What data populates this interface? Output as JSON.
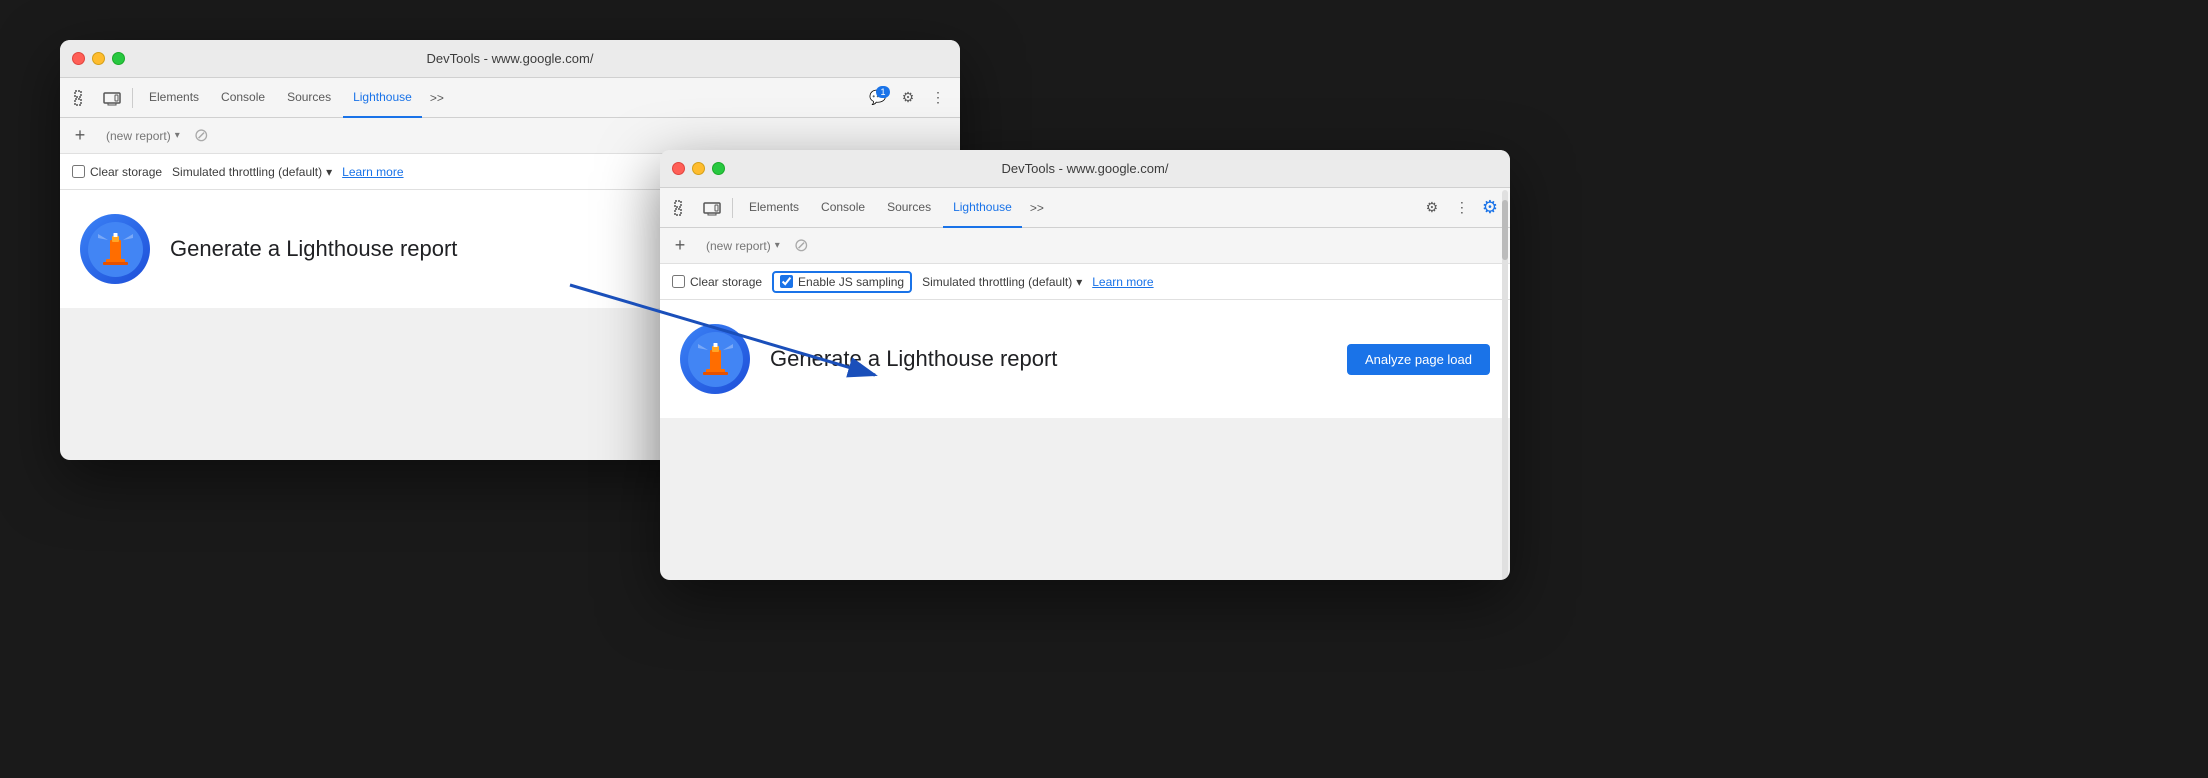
{
  "background": "#1a1a1a",
  "window1": {
    "title": "DevTools - www.google.com/",
    "tabs": [
      {
        "label": "Elements",
        "active": false
      },
      {
        "label": "Console",
        "active": false
      },
      {
        "label": "Sources",
        "active": false
      },
      {
        "label": "Lighthouse",
        "active": true
      }
    ],
    "more_tabs": ">>",
    "badge_count": "1",
    "report_placeholder": "(new report)",
    "clear_storage_label": "Clear storage",
    "throttling_label": "Simulated throttling (default)",
    "learn_more": "Learn more",
    "generate_text": "Generate a Lighthouse report"
  },
  "window2": {
    "title": "DevTools - www.google.com/",
    "tabs": [
      {
        "label": "Elements",
        "active": false
      },
      {
        "label": "Console",
        "active": false
      },
      {
        "label": "Sources",
        "active": false
      },
      {
        "label": "Lighthouse",
        "active": true
      }
    ],
    "more_tabs": ">>",
    "report_placeholder": "(new report)",
    "clear_storage_label": "Clear storage",
    "enable_js_sampling_label": "Enable JS sampling",
    "throttling_label": "Simulated throttling (default)",
    "learn_more": "Learn more",
    "generate_text": "Generate a Lighthouse report",
    "analyze_btn": "Analyze page load"
  },
  "icons": {
    "cursor_icon": "⬚",
    "device_icon": "⬚",
    "plus_icon": "+",
    "no_circle": "⊘",
    "chevron_down": "▾",
    "gear_icon": "⚙",
    "more_icon": "⋮",
    "comment_icon": "💬",
    "gear_blue_icon": "⚙"
  }
}
